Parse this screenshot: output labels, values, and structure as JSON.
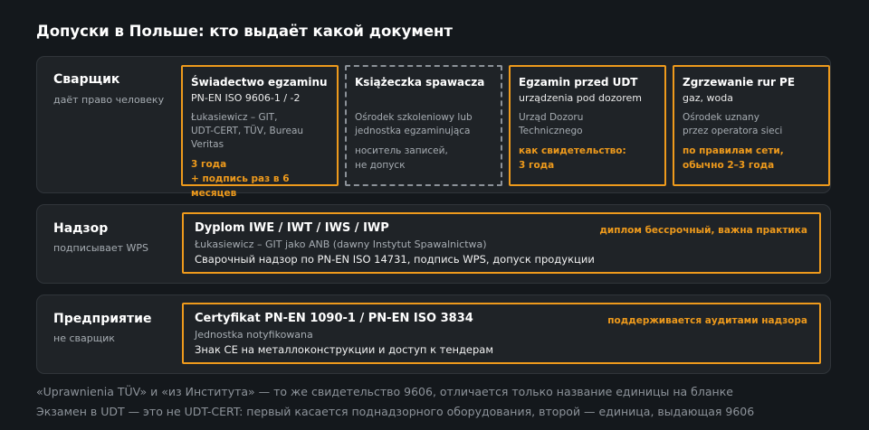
{
  "title": "Допуски в Польше: кто выдаёт какой документ",
  "welder": {
    "title": "Сварщик",
    "subtitle": "даёт право человеку",
    "cards": [
      {
        "name": "Świadectwo egzaminu",
        "standard": "PN-EN ISO 9606-1 / -2",
        "issuers": "Łukasiewicz – GIT,\nUDT-CERT, TÜV, Bureau Veritas",
        "note": "3 года\n+ подпись раз в 6 месяцев"
      },
      {
        "name": "Książeczka spawacza",
        "issuers": "Ośrodek szkoleniowy lub\njednostka egzaminująca",
        "note": "носитель записей,\nне допуск"
      },
      {
        "name": "Egzamin przed UDT",
        "standard": "urządzenia pod dozorem",
        "issuers": "Urząd Dozoru\nTechnicznego",
        "note": "как свидетельство:\n3 года"
      },
      {
        "name": "Zgrzewanie rur PE",
        "standard": "gaz, woda",
        "issuers": "Ośrodek uznany\nprzez operatora sieci",
        "note": "по правилам сети,\nобычно 2–3 года"
      }
    ]
  },
  "supervision": {
    "title": "Надзор",
    "subtitle": "подписывает WPS",
    "card": {
      "name": "Dyplom IWE / IWT / IWS / IWP",
      "issuer": "Łukasiewicz – GIT jako ANB (dawny Instytut Spawalnictwa)",
      "description": "Сварочный надзор по PN-EN ISO 14731, подпись WPS, допуск продукции",
      "note": "диплом бессрочный, важна практика"
    }
  },
  "company": {
    "title": "Предприятие",
    "subtitle": "не сварщик",
    "card": {
      "name": "Certyfikat PN-EN 1090-1 / PN-EN ISO 3834",
      "issuer": "Jednostka notyfikowana",
      "description": "Знак CE на металлоконструкции и доступ к тендерам",
      "note": "поддерживается аудитами надзора"
    }
  },
  "footer": {
    "line1": "«Uprawnienia TÜV» и «из Института» — то же свидетельство 9606, отличается только название единицы на бланке",
    "line2": "Экзамен в UDT — это не UDT-CERT: первый касается поднадзорного оборудования, второй — единица, выдающая 9606"
  },
  "colors": {
    "accent": "#ee9a1c",
    "background": "#14181c",
    "panel": "#1f2327",
    "muted_text": "#a6acb2"
  }
}
